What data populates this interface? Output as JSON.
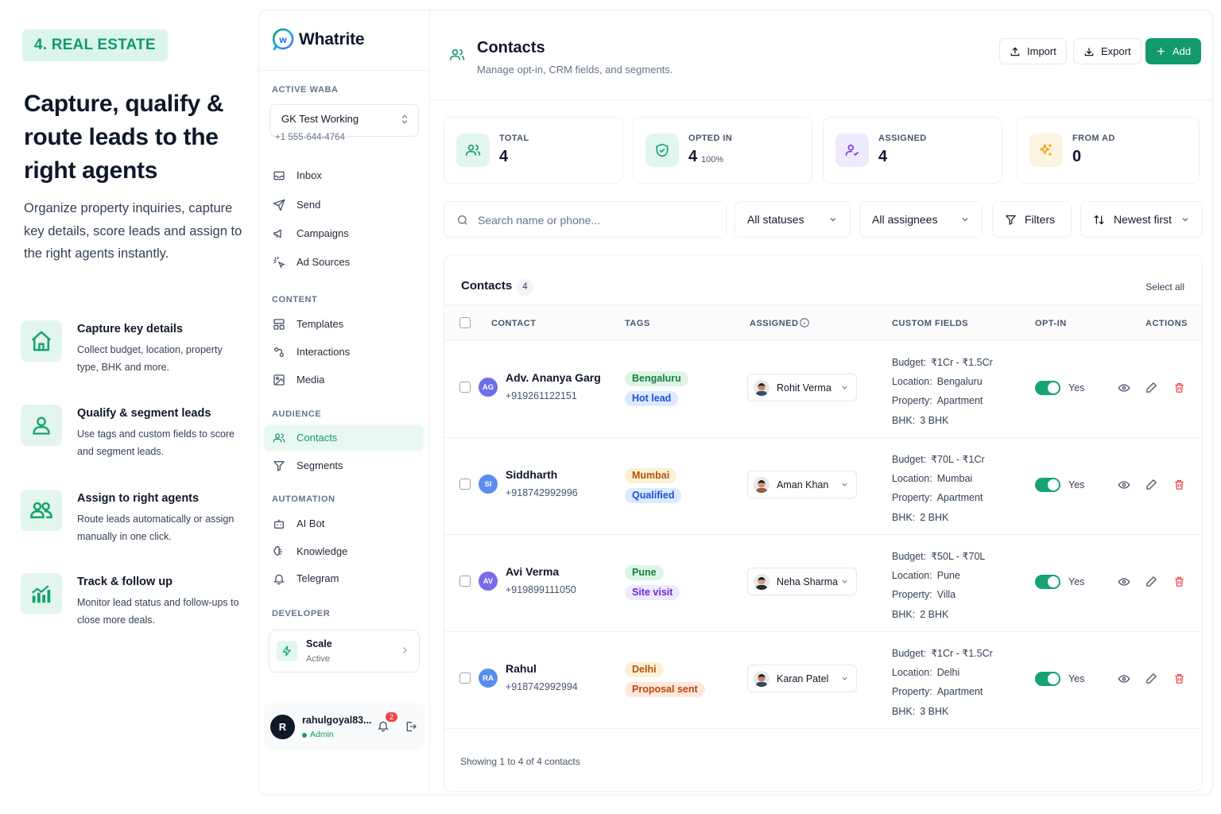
{
  "promo": {
    "badge": "4. REAL ESTATE",
    "title": "Capture, qualify & route leads to the right agents",
    "description": "Organize property inquiries, capture key details, score leads and assign to the right agents instantly.",
    "features": [
      {
        "icon": "house-icon",
        "title": "Capture key details",
        "desc": "Collect budget, location, property type, BHK and more."
      },
      {
        "icon": "user-icon",
        "title": "Qualify & segment leads",
        "desc": "Use tags and custom fields to score and segment leads."
      },
      {
        "icon": "users-icon",
        "title": "Assign to right agents",
        "desc": "Route leads automatically or assign manually in one click."
      },
      {
        "icon": "growth-chart-icon",
        "title": "Track & follow up",
        "desc": "Monitor lead status and follow-ups to close more deals."
      }
    ]
  },
  "sidebar": {
    "brand": "Whatrite",
    "active_waba_label": "ACTIVE WABA",
    "waba_name": "GK Test Working",
    "waba_phone": "+1 555-644-4764",
    "nav_top": [
      {
        "label": "Inbox",
        "icon": "inbox-icon"
      },
      {
        "label": "Send",
        "icon": "send-icon"
      },
      {
        "label": "Campaigns",
        "icon": "megaphone-icon"
      },
      {
        "label": "Ad Sources",
        "icon": "sparkle-pointer-icon"
      }
    ],
    "content_label": "CONTENT",
    "nav_content": [
      {
        "label": "Templates",
        "icon": "templates-icon"
      },
      {
        "label": "Interactions",
        "icon": "interactions-icon"
      },
      {
        "label": "Media",
        "icon": "image-icon"
      }
    ],
    "audience_label": "AUDIENCE",
    "nav_audience": [
      {
        "label": "Contacts",
        "icon": "users-icon",
        "active": true
      },
      {
        "label": "Segments",
        "icon": "filter-icon"
      }
    ],
    "automation_label": "AUTOMATION",
    "nav_automation": [
      {
        "label": "AI Bot",
        "icon": "bot-icon"
      },
      {
        "label": "Knowledge",
        "icon": "brain-icon"
      },
      {
        "label": "Telegram",
        "icon": "bell-icon"
      }
    ],
    "developer_label": "DEVELOPER",
    "plan_name": "Scale",
    "plan_status": "Active",
    "user_initial": "R",
    "user_name": "rahulgoyal83...",
    "user_role": "Admin",
    "notifications": "2"
  },
  "header": {
    "title": "Contacts",
    "subtitle": "Manage opt-in, CRM fields, and segments.",
    "import_label": "Import",
    "export_label": "Export",
    "add_label": "Add"
  },
  "stats": [
    {
      "label": "TOTAL",
      "value": "4",
      "icon": "users-icon",
      "color": "#13a36f",
      "bg": "#e3f6ee"
    },
    {
      "label": "OPTED IN",
      "value": "4",
      "extra": "100%",
      "icon": "shield-check-icon",
      "color": "#13a36f",
      "bg": "#e3f6ee"
    },
    {
      "label": "ASSIGNED",
      "value": "4",
      "icon": "user-check-icon",
      "color": "#7c3aed",
      "bg": "#efe9fd"
    },
    {
      "label": "FROM AD",
      "value": "0",
      "icon": "sparkles-icon",
      "color": "#f59e0b",
      "bg": "#fdf3e1"
    }
  ],
  "filters": {
    "search_placeholder": "Search name or phone...",
    "status": "All statuses",
    "assignee": "All assignees",
    "filters_label": "Filters",
    "sort": "Newest first"
  },
  "table": {
    "title": "Contacts",
    "count": "4",
    "select_all": "Select all",
    "columns": [
      "CONTACT",
      "TAGS",
      "ASSIGNED",
      "CUSTOM FIELDS",
      "OPT-IN",
      "ACTIONS"
    ],
    "rows": [
      {
        "initials": "AG",
        "avatar_color": "#6d6ee8",
        "name": "Adv. Ananya Garg",
        "phone": "+919261122151",
        "tags": [
          {
            "text": "Bengaluru",
            "bg": "#dcf5e6",
            "fg": "#15803d"
          },
          {
            "text": "Hot lead",
            "bg": "#dbeafe",
            "fg": "#1d4ed8"
          }
        ],
        "assignee": "Rohit Verma",
        "fields": [
          {
            "k": "Budget:",
            "v": "₹1Cr - ₹1.5Cr"
          },
          {
            "k": "Location:",
            "v": "Bengaluru"
          },
          {
            "k": "Property:",
            "v": "Apartment"
          },
          {
            "k": "BHK:",
            "v": "3 BHK"
          }
        ],
        "optin": "Yes"
      },
      {
        "initials": "SI",
        "avatar_color": "#5b8def",
        "name": "Siddharth",
        "phone": "+918742992996",
        "tags": [
          {
            "text": "Mumbai",
            "bg": "#fdf0d5",
            "fg": "#b45309"
          },
          {
            "text": "Qualified",
            "bg": "#dbeafe",
            "fg": "#1d4ed8"
          }
        ],
        "assignee": "Aman Khan",
        "fields": [
          {
            "k": "Budget:",
            "v": "₹70L - ₹1Cr"
          },
          {
            "k": "Location:",
            "v": "Mumbai"
          },
          {
            "k": "Property:",
            "v": "Apartment"
          },
          {
            "k": "BHK:",
            "v": "2 BHK"
          }
        ],
        "optin": "Yes"
      },
      {
        "initials": "AV",
        "avatar_color": "#7b6be8",
        "name": "Avi Verma",
        "phone": "+919899111050",
        "tags": [
          {
            "text": "Pune",
            "bg": "#dcf5e6",
            "fg": "#15803d"
          },
          {
            "text": "Site visit",
            "bg": "#ede9fe",
            "fg": "#6d28d9"
          }
        ],
        "assignee": "Neha Sharma",
        "fields": [
          {
            "k": "Budget:",
            "v": "₹50L - ₹70L"
          },
          {
            "k": "Location:",
            "v": "Pune"
          },
          {
            "k": "Property:",
            "v": "Villa"
          },
          {
            "k": "BHK:",
            "v": "2 BHK"
          }
        ],
        "optin": "Yes"
      },
      {
        "initials": "RA",
        "avatar_color": "#5b8def",
        "name": "Rahul",
        "phone": "+918742992994",
        "tags": [
          {
            "text": "Delhi",
            "bg": "#fdf0d5",
            "fg": "#b45309"
          },
          {
            "text": "Proposal sent",
            "bg": "#fde8dc",
            "fg": "#c2410c"
          }
        ],
        "assignee": "Karan Patel",
        "fields": [
          {
            "k": "Budget:",
            "v": "₹1Cr - ₹1.5Cr"
          },
          {
            "k": "Location:",
            "v": "Delhi"
          },
          {
            "k": "Property:",
            "v": "Apartment"
          },
          {
            "k": "BHK:",
            "v": "3 BHK"
          }
        ],
        "optin": "Yes"
      }
    ],
    "footer": "Showing 1 to 4 of 4 contacts"
  }
}
